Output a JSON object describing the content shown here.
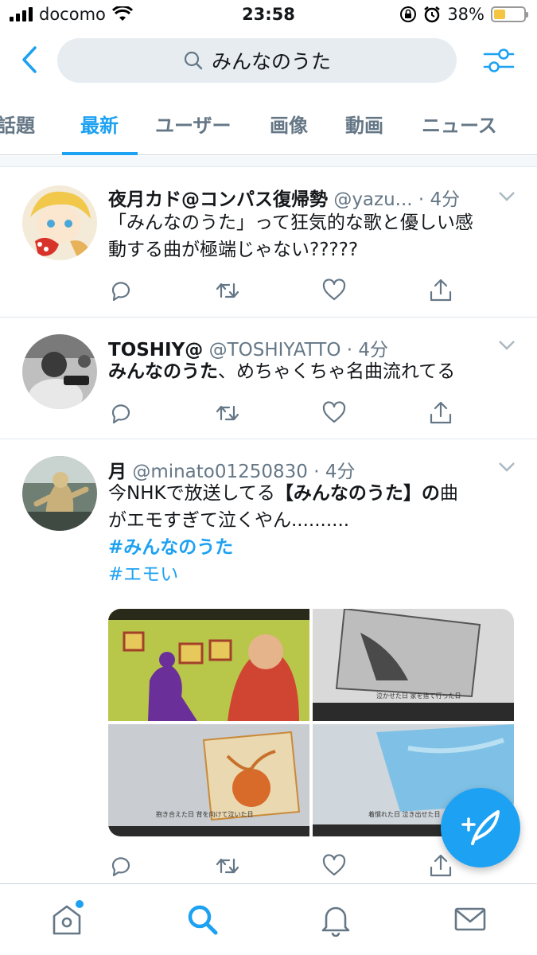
{
  "status_bar": {
    "carrier": "docomo",
    "time": "23:58",
    "battery": "38%",
    "battery_level": 0.38
  },
  "search": {
    "query": "みんなのうた"
  },
  "tabs": [
    {
      "label": "話題",
      "active": false
    },
    {
      "label": "最新",
      "active": true
    },
    {
      "label": "ユーザー",
      "active": false
    },
    {
      "label": "画像",
      "active": false
    },
    {
      "label": "動画",
      "active": false
    },
    {
      "label": "ニュース",
      "active": false
    }
  ],
  "tweets": [
    {
      "name": "夜月カド@コンパス復帰勢",
      "handle": "@yazu...",
      "time": "· 4分",
      "text_lines": [
        "「みんなのうた」って狂気的な歌と優しい感",
        "動する曲が極端じゃない?????"
      ]
    },
    {
      "name": "TOSHIY@",
      "handle": "@TOSHIYATTO",
      "time": "· 4分",
      "text_bold": "みんなのうた",
      "text_rest": "、めちゃくちゃ名曲流れてる"
    },
    {
      "name": "月",
      "handle": "@minato01250830",
      "time": "· 4分",
      "text_a": "今NHKで放送してる",
      "text_bold": "【みんなのうた】の",
      "text_b": "曲",
      "text_line2": "がエモすぎて泣くやん..........",
      "hashtags": [
        "#みんなのうた",
        "#エモい"
      ]
    }
  ],
  "colors": {
    "accent": "#1da1f2",
    "text": "#14171a",
    "secondary": "#657786",
    "divider": "#e1e8ed"
  }
}
